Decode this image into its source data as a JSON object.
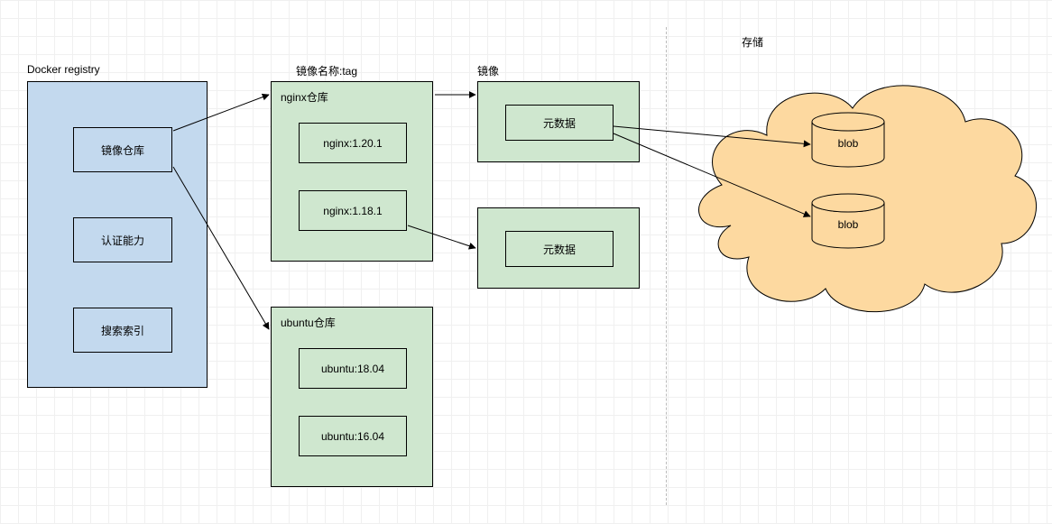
{
  "labels": {
    "registry": "Docker registry",
    "tagCol": "镜像名称:tag",
    "metaCol": "镜像",
    "storeCol": "存储"
  },
  "registry": {
    "imgRepo": "镜像仓库",
    "auth": "认证能力",
    "index": "搜索索引"
  },
  "nginx": {
    "title": "nginx仓库",
    "v1": "nginx:1.20.1",
    "v2": "nginx:1.18.1"
  },
  "ubuntu": {
    "title": "ubuntu仓库",
    "v1": "ubuntu:18.04",
    "v2": "ubuntu:16.04"
  },
  "meta": {
    "m1": "元数据",
    "m2": "元数据"
  },
  "blob": {
    "b1": "blob",
    "b2": "blob"
  }
}
